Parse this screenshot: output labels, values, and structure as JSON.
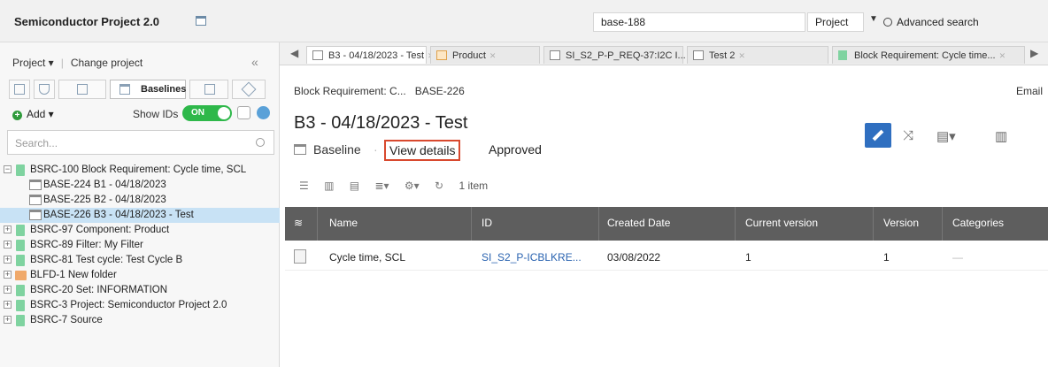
{
  "header": {
    "app_title": "Semiconductor Project 2.0",
    "search_value": "base-188",
    "scope_select": "Project",
    "advanced_search": "Advanced search"
  },
  "sidebar": {
    "project_menu": "Project ▾",
    "change_project": "Change project",
    "collapse": "«",
    "active_tab": "Baselines",
    "add_label": "Add ▾",
    "show_ids_label": "Show IDs",
    "toggle_label": "ON",
    "search_placeholder": "Search...",
    "tree": [
      {
        "label": "BSRC-100 Block Requirement: Cycle time, SCL",
        "expander": "−",
        "icon": "green"
      },
      {
        "label": "BASE-224 B1 - 04/18/2023",
        "icon": "baseline"
      },
      {
        "label": "BASE-225 B2 - 04/18/2023",
        "icon": "baseline"
      },
      {
        "label": "BASE-226 B3 - 04/18/2023 - Test",
        "icon": "baseline",
        "selected": true
      },
      {
        "label": "BSRC-97 Component: Product",
        "expander": "+",
        "icon": "green"
      },
      {
        "label": "BSRC-89 Filter: My Filter",
        "expander": "+",
        "icon": "green"
      },
      {
        "label": "BSRC-81 Test cycle: Test Cycle B",
        "expander": "+",
        "icon": "green"
      },
      {
        "label": "BLFD-1 New folder",
        "expander": "+",
        "icon": "folder"
      },
      {
        "label": "BSRC-20 Set: INFORMATION",
        "expander": "+",
        "icon": "green"
      },
      {
        "label": "BSRC-3 Project: Semiconductor Project 2.0",
        "expander": "+",
        "icon": "green"
      },
      {
        "label": "BSRC-7 Source",
        "expander": "+",
        "icon": "green"
      }
    ]
  },
  "tabs": [
    {
      "label": "B3 - 04/18/2023 - Test",
      "icon": "baseline"
    },
    {
      "label": "Product",
      "icon": "grid"
    },
    {
      "label": "SI_S2_P-P_REQ-37:I2C I...",
      "icon": "doc"
    },
    {
      "label": "Test 2",
      "icon": "doc"
    },
    {
      "label": "Block Requirement: Cycle time...",
      "icon": "green"
    }
  ],
  "main": {
    "breadcrumb_1": "Block Requirement: C...",
    "breadcrumb_2": "BASE-226",
    "email": "Email",
    "title": "B3 - 04/18/2023 - Test",
    "baseline_label": "Baseline",
    "view_details": "View details",
    "status": "Approved",
    "item_count": "1 item"
  },
  "table": {
    "columns": [
      "Name",
      "ID",
      "Created Date",
      "Current version",
      "Version",
      "Categories"
    ],
    "rows": [
      {
        "name": "Cycle time, SCL",
        "id": "SI_S2_P-ICBLKRE...",
        "created": "03/08/2022",
        "current_version": "1",
        "version": "1",
        "categories": "—"
      }
    ]
  },
  "colors": {
    "accent": "#2f6fc0",
    "toggle_on": "#2eb84a",
    "highlight_border": "#d8492e",
    "selected_row": "#c8e2f5",
    "table_header": "#5e5e5e"
  }
}
